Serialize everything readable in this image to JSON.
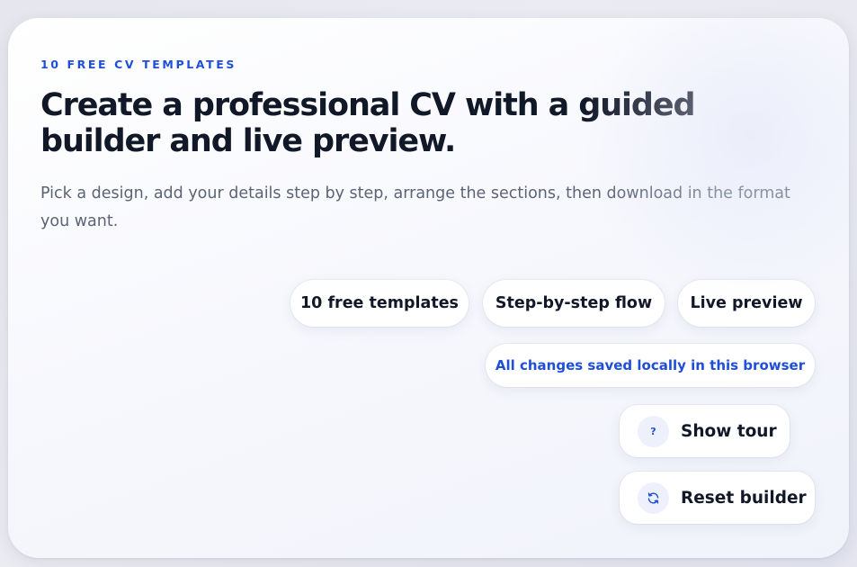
{
  "hero": {
    "eyebrow": "10 FREE CV TEMPLATES",
    "title": "Create a professional CV with a guided builder and live preview.",
    "subtitle": "Pick a design, add your details step by step, arrange the sections, then download in the format you want."
  },
  "features": [
    {
      "label": "10 free templates"
    },
    {
      "label": "Step-by-step flow"
    },
    {
      "label": "Live preview"
    }
  ],
  "save_status": "All changes saved locally in this browser",
  "actions": {
    "tour": {
      "label": "Show tour",
      "icon": "question-icon"
    },
    "reset": {
      "label": "Reset builder",
      "icon": "refresh-icon"
    }
  },
  "colors": {
    "accent": "#1f4fd8",
    "heading": "#111827",
    "body_text": "#5b6475",
    "icon_bg": "#eef1fb"
  }
}
